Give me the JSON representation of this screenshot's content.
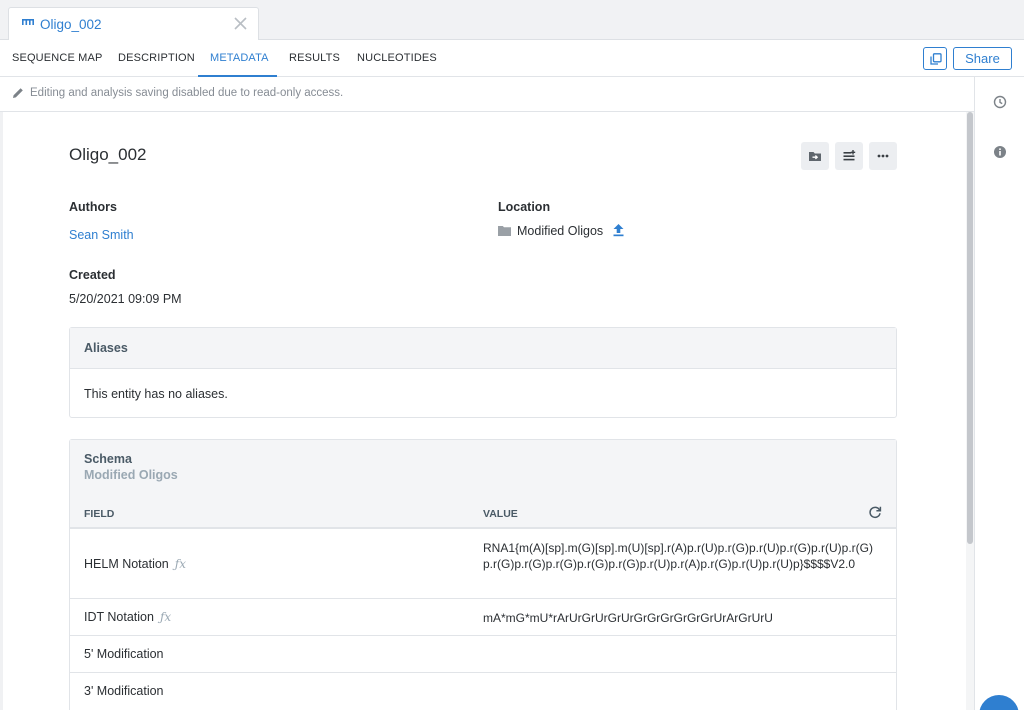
{
  "window": {
    "tab_title": "Oligo_002",
    "tab_icon": "sequence-icon",
    "close_icon": "close-icon"
  },
  "nav": {
    "tabs": [
      {
        "label": "SEQUENCE MAP"
      },
      {
        "label": "DESCRIPTION"
      },
      {
        "label": "METADATA"
      },
      {
        "label": "RESULTS"
      },
      {
        "label": "NUCLEOTIDES"
      }
    ],
    "active_tab": "METADATA",
    "share_label": "Share",
    "copy_icon": "copy-icon"
  },
  "readonly": {
    "message": "Editing and analysis saving disabled due to read-only access.",
    "icon": "pencil-icon"
  },
  "rail": {
    "icons": [
      "history-icon",
      "info-icon"
    ]
  },
  "entity": {
    "title": "Oligo_002",
    "actions": [
      "move-to-folder-icon",
      "adjust-icon",
      "more-icon"
    ],
    "authors_label": "Authors",
    "authors_value": "Sean Smith",
    "location_label": "Location",
    "location_value": "Modified Oligos",
    "created_label": "Created",
    "created_value": "5/20/2021 09:09 PM"
  },
  "aliases": {
    "title": "Aliases",
    "empty_text": "This entity has no aliases."
  },
  "schema": {
    "title": "Schema",
    "name": "Modified Oligos",
    "field_col": "FIELD",
    "value_col": "VALUE",
    "fx_symbol": "ƒx",
    "rows": [
      {
        "field": "HELM Notation",
        "computed": true,
        "value": "RNA1{m(A)[sp].m(G)[sp].m(U)[sp].r(A)p.r(U)p.r(G)p.r(U)p.r(G)p.r(U)p.r(G)p.r(G)p.r(G)p.r(G)p.r(G)p.r(G)p.r(U)p.r(A)p.r(G)p.r(U)p.r(U)p}$$$$V2.0"
      },
      {
        "field": "IDT Notation",
        "computed": true,
        "value": "mA*mG*mU*rArUrGrUrGrUrGrGrGrGrGrGrUrArGrUrU"
      },
      {
        "field": "5' Modification",
        "computed": false,
        "value": ""
      },
      {
        "field": "3' Modification",
        "computed": false,
        "value": ""
      }
    ]
  },
  "colors": {
    "accent": "#2f7fd0",
    "text": "#2b2f33",
    "muted": "#868c94",
    "header_bg": "#f4f5f7"
  }
}
